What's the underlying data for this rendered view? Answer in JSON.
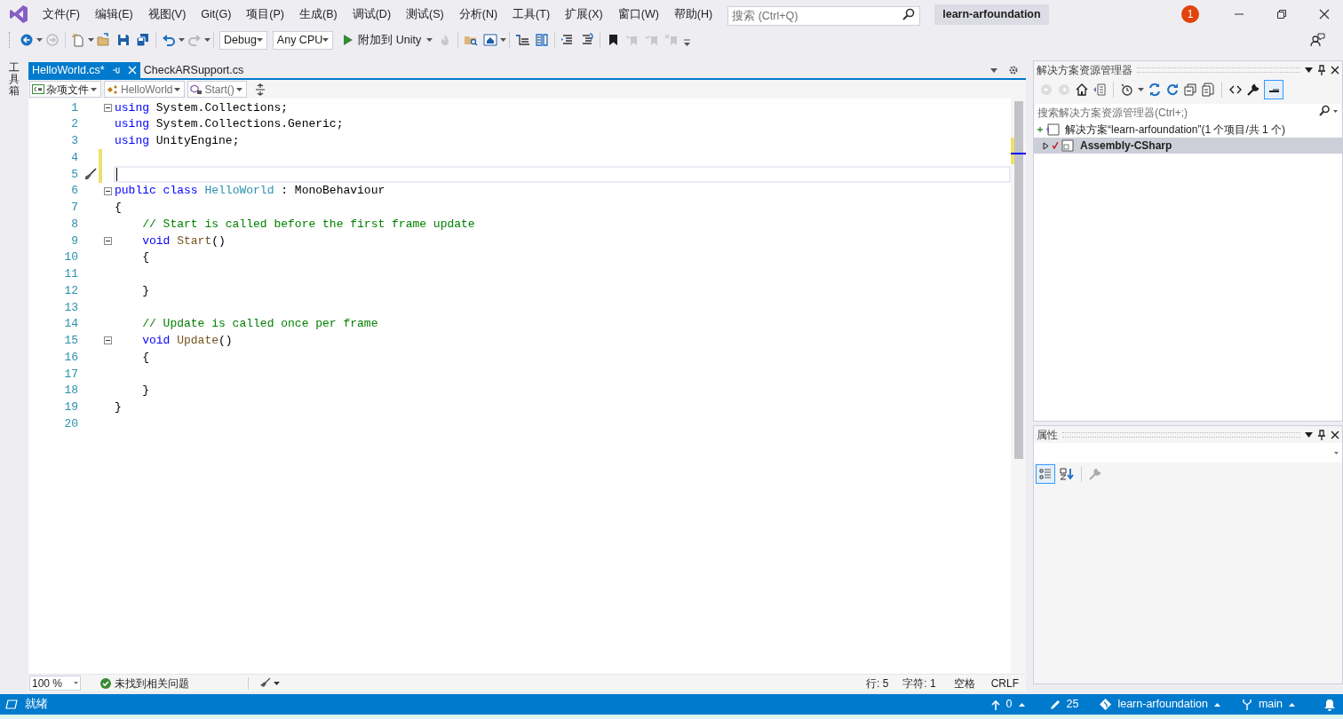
{
  "title_bar": {
    "menu": [
      "文件(F)",
      "编辑(E)",
      "视图(V)",
      "Git(G)",
      "项目(P)",
      "生成(B)",
      "调试(D)",
      "测试(S)",
      "分析(N)",
      "工具(T)",
      "扩展(X)",
      "窗口(W)",
      "帮助(H)"
    ],
    "search": {
      "placeholder": "搜索 (Ctrl+Q)"
    },
    "solution_name": "learn-arfoundation",
    "notification_count": "1"
  },
  "toolbar": {
    "configuration": "Debug",
    "platform": "Any CPU",
    "run_target": "附加到 Unity"
  },
  "toolbox_label": "工具箱",
  "editor": {
    "tabs": [
      {
        "label": "HelloWorld.cs*",
        "selected": true
      },
      {
        "label": "CheckARSupport.cs",
        "selected": false
      }
    ],
    "navigation": {
      "project": "杂项文件",
      "type": "HelloWorld",
      "member": "Start()"
    },
    "lines": [
      {
        "number": "1",
        "foldable": true,
        "tokens": [
          {
            "kind": "keyword",
            "text": "using"
          },
          {
            "kind": "plain",
            "text": " System.Collections;"
          }
        ]
      },
      {
        "number": "2",
        "tokens": [
          {
            "kind": "keyword",
            "text": "using"
          },
          {
            "kind": "plain",
            "text": " System.Collections.Generic;"
          }
        ]
      },
      {
        "number": "3",
        "tokens": [
          {
            "kind": "keyword",
            "text": "using"
          },
          {
            "kind": "plain",
            "text": " UnityEngine;"
          }
        ]
      },
      {
        "number": "4",
        "changed": true
      },
      {
        "number": "5",
        "changed": true,
        "current": true
      },
      {
        "number": "6",
        "foldable": true,
        "tokens": [
          {
            "kind": "keyword",
            "text": "public class "
          },
          {
            "kind": "type",
            "text": "HelloWorld"
          },
          {
            "kind": "plain",
            "text": " : MonoBehaviour"
          }
        ]
      },
      {
        "number": "7",
        "tokens": [
          {
            "kind": "plain",
            "text": "{"
          }
        ]
      },
      {
        "number": "8",
        "tokens": [
          {
            "kind": "comment",
            "text": "    // Start is called before the first frame update"
          }
        ]
      },
      {
        "number": "9",
        "foldable": true,
        "tokens": [
          {
            "kind": "keyword",
            "text": "    void "
          },
          {
            "kind": "method",
            "text": "Start"
          },
          {
            "kind": "plain",
            "text": "()"
          }
        ]
      },
      {
        "number": "10",
        "tokens": [
          {
            "kind": "plain",
            "text": "    {"
          }
        ]
      },
      {
        "number": "11"
      },
      {
        "number": "12",
        "tokens": [
          {
            "kind": "plain",
            "text": "    }"
          }
        ]
      },
      {
        "number": "13"
      },
      {
        "number": "14",
        "tokens": [
          {
            "kind": "comment",
            "text": "    // Update is called once per frame"
          }
        ]
      },
      {
        "number": "15",
        "foldable": true,
        "tokens": [
          {
            "kind": "keyword",
            "text": "    void "
          },
          {
            "kind": "method",
            "text": "Update"
          },
          {
            "kind": "plain",
            "text": "()"
          }
        ]
      },
      {
        "number": "16",
        "tokens": [
          {
            "kind": "plain",
            "text": "    {"
          }
        ]
      },
      {
        "number": "17"
      },
      {
        "number": "18",
        "tokens": [
          {
            "kind": "plain",
            "text": "    }"
          }
        ]
      },
      {
        "number": "19",
        "tokens": [
          {
            "kind": "plain",
            "text": "}"
          }
        ]
      },
      {
        "number": "20"
      }
    ],
    "status": {
      "zoom": "100 %",
      "issues": "未找到相关问题",
      "line": "行: 5",
      "column": "字符: 1",
      "indent": "空格",
      "line_ending": "CRLF"
    }
  },
  "solution_explorer": {
    "title": "解决方案资源管理器",
    "search": {
      "placeholder": "搜索解决方案资源管理器(Ctrl+;)"
    },
    "tree": [
      {
        "label": "解决方案“learn-arfoundation”(1 个项目/共 1 个)",
        "selected": false,
        "children": [
          {
            "label": "Assembly-CSharp",
            "selected": true,
            "expanded": false
          }
        ]
      }
    ]
  },
  "properties": {
    "title": "属性"
  },
  "status_bar": {
    "message": "就绪",
    "items": [
      {
        "kind": "push",
        "text": "0"
      },
      {
        "kind": "changes",
        "text": "25"
      },
      {
        "kind": "repo",
        "text": "learn-arfoundation"
      },
      {
        "kind": "branch",
        "text": "main"
      }
    ]
  }
}
